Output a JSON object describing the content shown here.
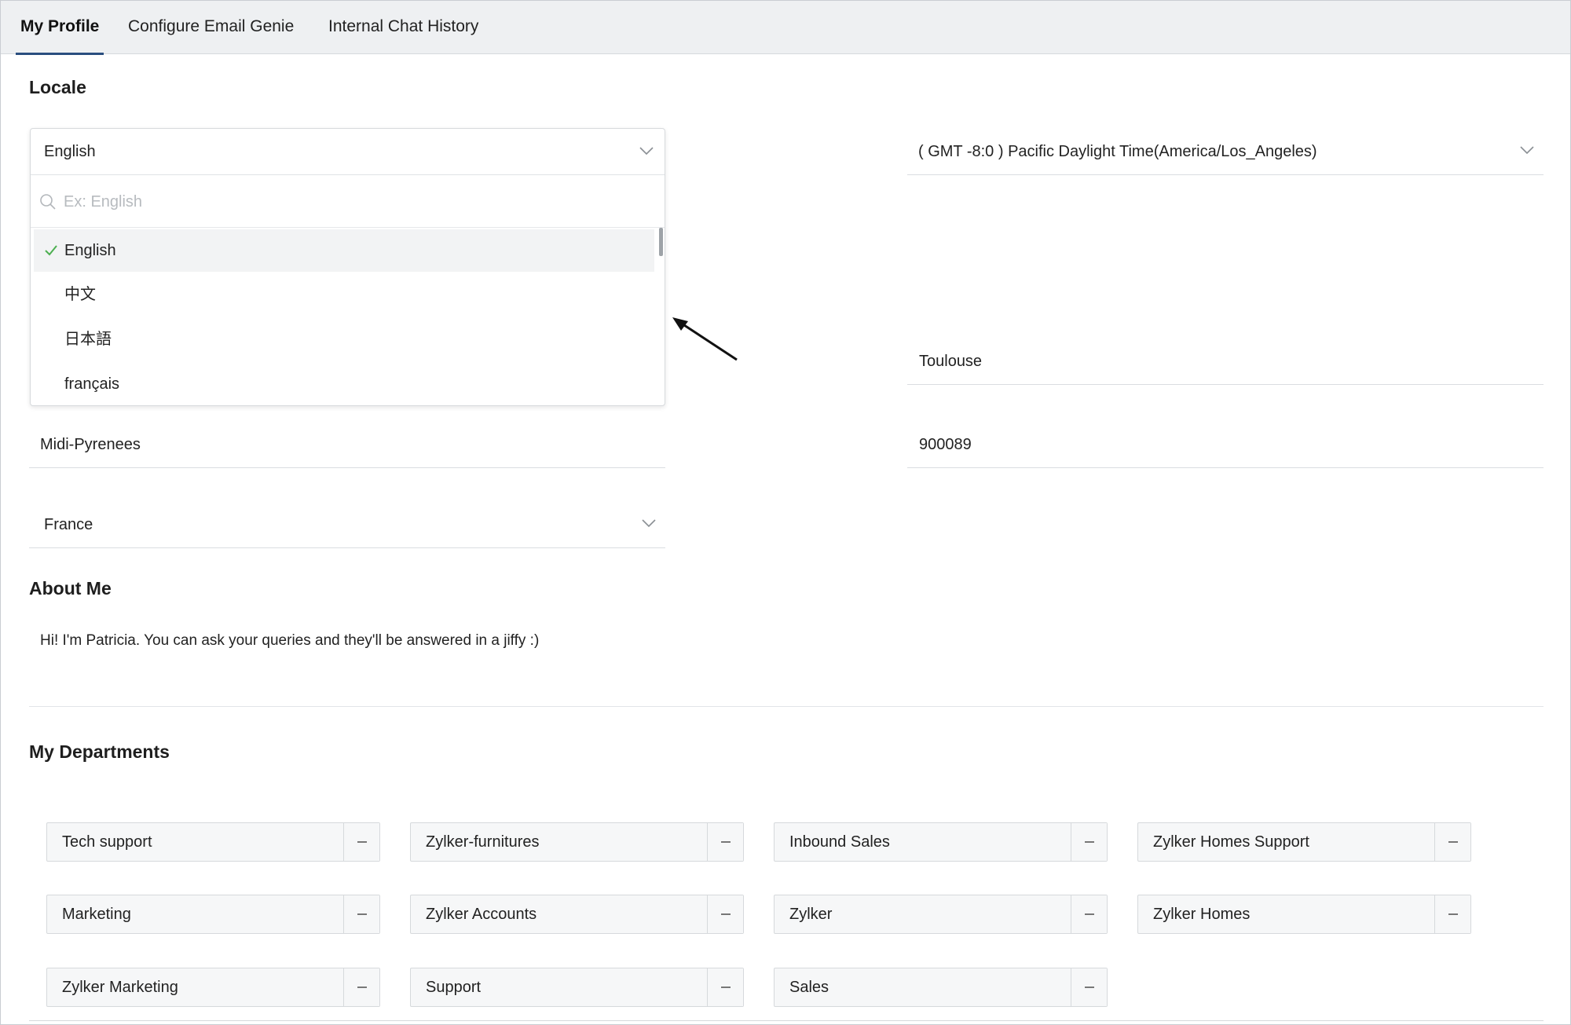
{
  "tabs": [
    {
      "label": "My Profile"
    },
    {
      "label": "Configure Email Genie"
    },
    {
      "label": "Internal Chat History"
    }
  ],
  "locale": {
    "title": "Locale",
    "language": {
      "value": "English",
      "search_placeholder": "Ex: English",
      "options": [
        {
          "label": "English"
        },
        {
          "label": "中文"
        },
        {
          "label": "日本語"
        },
        {
          "label": "français"
        }
      ]
    },
    "timezone": "( GMT -8:0 ) Pacific Daylight Time(America/Los_Angeles)",
    "city": "Toulouse",
    "state": "Midi-Pyrenees",
    "zip": "900089",
    "country": "France"
  },
  "about": {
    "title": "About Me",
    "text": "Hi! I'm Patricia. You can ask your queries and they'll be answered in a jiffy :)"
  },
  "departments": {
    "title": "My Departments",
    "items": [
      {
        "label": "Tech support"
      },
      {
        "label": "Zylker-furnitures"
      },
      {
        "label": "Inbound Sales"
      },
      {
        "label": "Zylker Homes Support"
      },
      {
        "label": "Marketing"
      },
      {
        "label": "Zylker Accounts"
      },
      {
        "label": "Zylker"
      },
      {
        "label": "Zylker Homes"
      },
      {
        "label": "Zylker Marketing"
      },
      {
        "label": "Support"
      },
      {
        "label": "Sales"
      }
    ]
  }
}
